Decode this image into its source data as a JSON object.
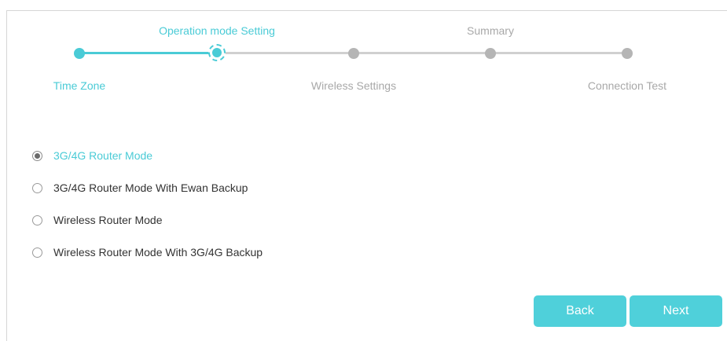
{
  "wizard": {
    "steps": [
      {
        "label": "Time Zone",
        "state": "done"
      },
      {
        "label": "Operation mode Setting",
        "state": "current"
      },
      {
        "label": "Wireless Settings",
        "state": "todo"
      },
      {
        "label": "Summary",
        "state": "todo"
      },
      {
        "label": "Connection Test",
        "state": "todo"
      }
    ]
  },
  "mode_options": [
    {
      "label": "3G/4G Router Mode",
      "selected": true
    },
    {
      "label": "3G/4G Router Mode With Ewan Backup",
      "selected": false
    },
    {
      "label": "Wireless Router Mode",
      "selected": false
    },
    {
      "label": "Wireless Router Mode With 3G/4G Backup",
      "selected": false
    }
  ],
  "buttons": {
    "back_label": "Back",
    "next_label": "Next"
  },
  "colors": {
    "accent": "#4acbd6",
    "button": "#4fd0da",
    "inactive_text": "#a8a8a8",
    "inactive_dot": "#b5b5b5"
  }
}
